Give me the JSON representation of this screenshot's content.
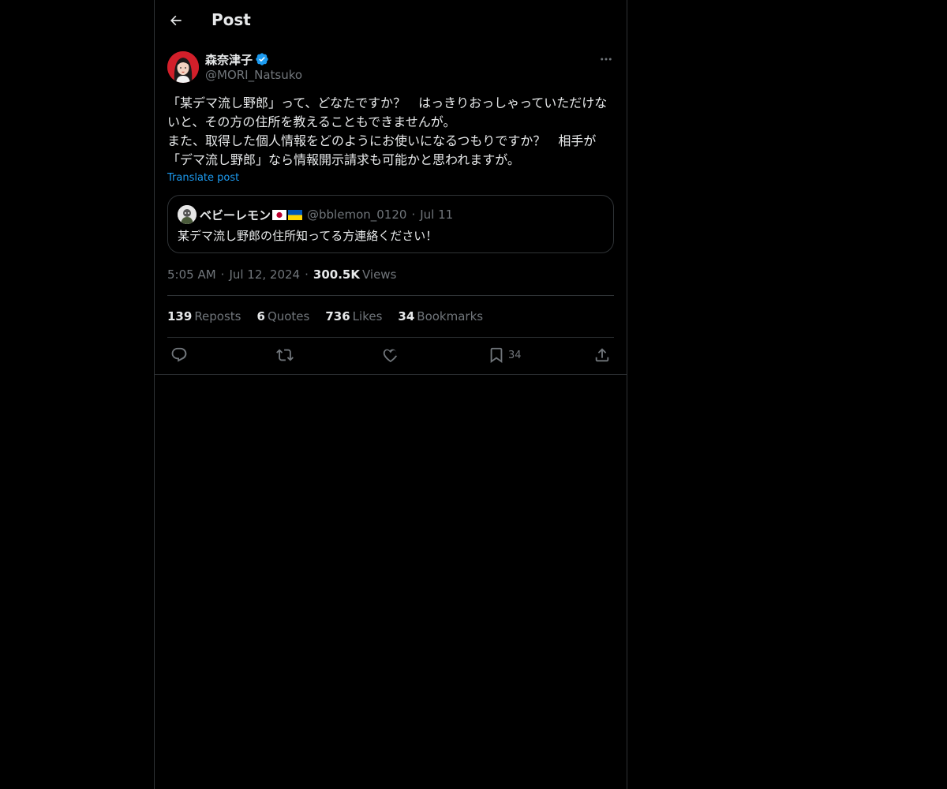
{
  "header": {
    "title": "Post",
    "back_icon": "arrow-left-icon"
  },
  "post": {
    "author": {
      "name": "森奈津子",
      "handle": "@MORI_Natsuko",
      "verified": true
    },
    "text": "「某デマ流し野郎」って、どなたですか？　はっきりおっしゃっていただけないと、その方の住所を教えることもできませんが。\nまた、取得した個人情報をどのようにお使いになるつもりですか？　相手が「デマ流し野郎」なら情報開示請求も可能かと思われますが。",
    "translate_label": "Translate post",
    "quote": {
      "name": "ベビーレモン",
      "flags": [
        "japan-flag",
        "ukraine-flag"
      ],
      "handle": "@bblemon_0120",
      "separator": "·",
      "date": "Jul 11",
      "text": "某デマ流し野郎の住所知ってる方連絡ください！"
    },
    "meta": {
      "time": "5:05 AM",
      "separator": "·",
      "date": "Jul 12, 2024",
      "views_count": "300.5K",
      "views_label": "Views"
    },
    "stats": [
      {
        "count": "139",
        "label": "Reposts"
      },
      {
        "count": "6",
        "label": "Quotes"
      },
      {
        "count": "736",
        "label": "Likes"
      },
      {
        "count": "34",
        "label": "Bookmarks"
      }
    ],
    "actions": {
      "reply_icon": "reply-icon",
      "repost_icon": "repost-icon",
      "like_icon": "heart-icon",
      "bookmark_icon": "bookmark-icon",
      "bookmark_count": "34",
      "share_icon": "share-icon"
    }
  },
  "colors": {
    "background": "#000000",
    "text": "#e7e9ea",
    "secondary": "#71767b",
    "accent": "#1d9bf0",
    "border": "#2f3336"
  }
}
